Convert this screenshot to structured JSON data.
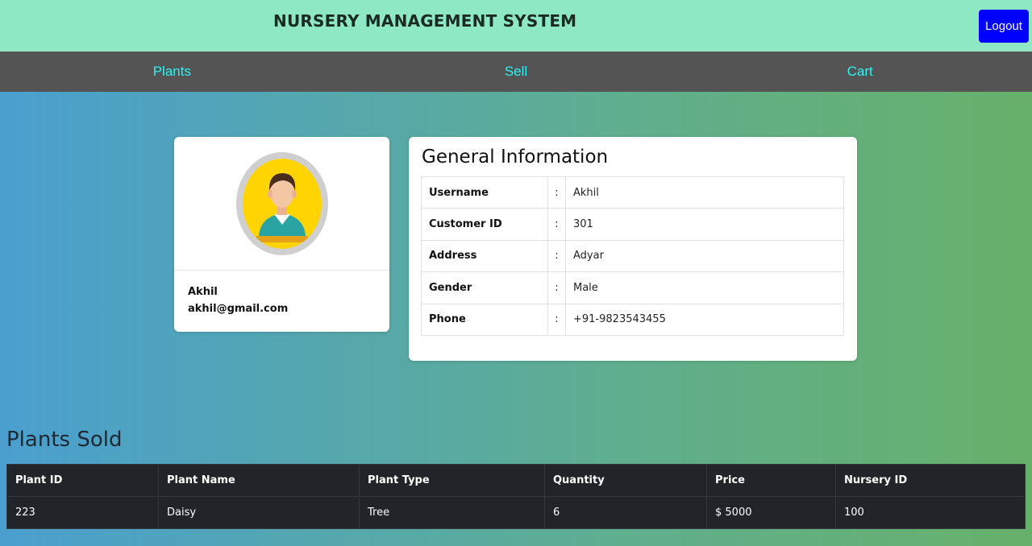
{
  "header": {
    "title": "NURSERY MANAGEMENT SYSTEM",
    "logout_label": "Logout"
  },
  "nav": {
    "items": [
      {
        "label": "Plants"
      },
      {
        "label": "Sell"
      },
      {
        "label": "Cart"
      }
    ],
    "link_color": "#2ff1f1"
  },
  "profile": {
    "name": "Akhil",
    "email": "akhil@gmail.com",
    "avatar_icon": "user-avatar-icon"
  },
  "general_info": {
    "title": "General Information",
    "separator": ":",
    "rows": [
      {
        "label": "Username",
        "value": "Akhil"
      },
      {
        "label": "Customer ID",
        "value": "301"
      },
      {
        "label": "Address",
        "value": "Adyar"
      },
      {
        "label": "Gender",
        "value": "Male"
      },
      {
        "label": "Phone",
        "value": "+91-9823543455"
      }
    ]
  },
  "plants_sold": {
    "title": "Plants Sold",
    "columns": [
      "Plant ID",
      "Plant Name",
      "Plant Type",
      "Quantity",
      "Price",
      "Nursery ID"
    ],
    "rows": [
      [
        "223",
        "Daisy",
        "Tree",
        "6",
        "$ 5000",
        "100"
      ]
    ]
  },
  "colors": {
    "header_bg": "#8de8c3",
    "nav_bg": "#545454",
    "logout_bg": "#0000ff",
    "table_bg": "#212529"
  }
}
